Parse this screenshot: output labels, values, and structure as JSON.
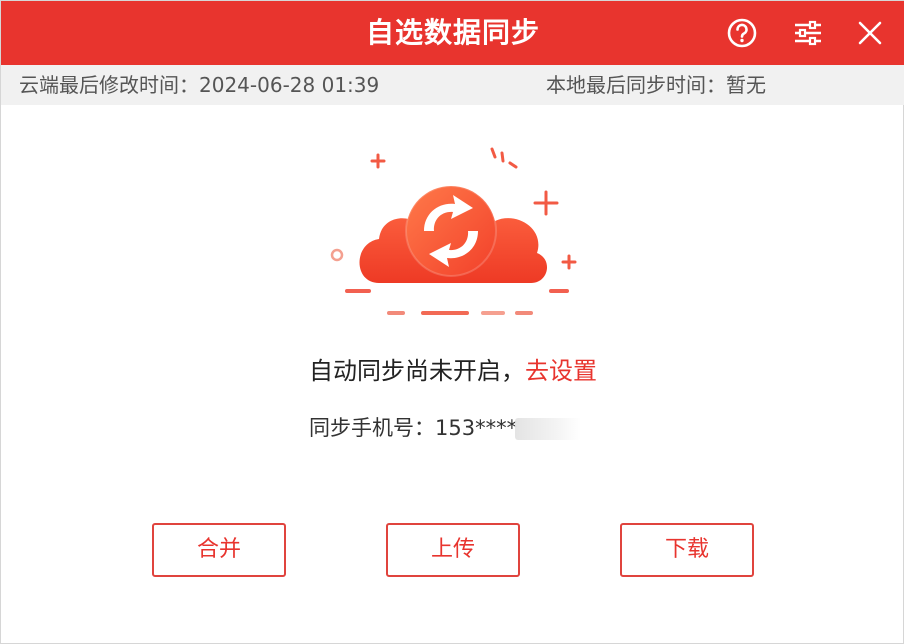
{
  "window": {
    "title": "自选数据同步"
  },
  "info": {
    "cloud_label": "云端最后修改时间：",
    "cloud_time": "2024-06-28 01:39",
    "local_label": "本地最后同步时间：",
    "local_time": "暂无"
  },
  "status": {
    "message": "自动同步尚未开启，",
    "action_link": "去设置"
  },
  "phone": {
    "label": "同步手机号：",
    "value": "153****"
  },
  "buttons": {
    "merge": "合并",
    "upload": "上传",
    "download": "下载"
  },
  "icons": {
    "help": "help-icon",
    "settings": "sliders-icon",
    "close": "close-icon",
    "illustration": "cloud-sync-icon"
  },
  "colors": {
    "accent": "#e8342e",
    "cloud": "#f4502e",
    "infobar_bg": "#f1f1f1"
  }
}
